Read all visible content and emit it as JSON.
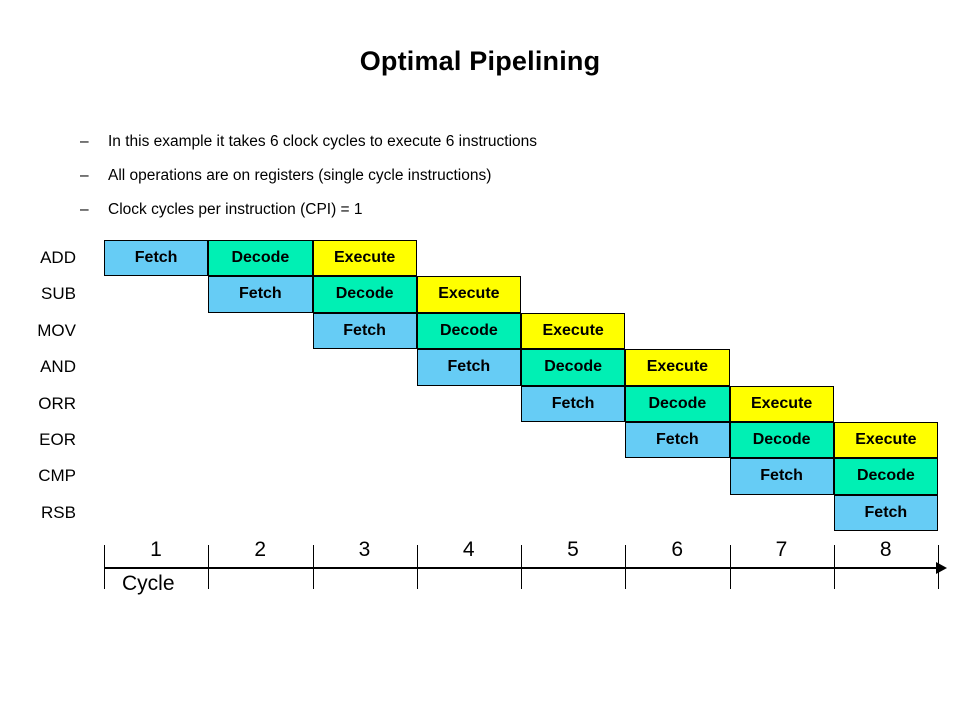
{
  "slide": {
    "title": "Optimal Pipelining",
    "bullet_marker": "–",
    "bullets": [
      "In this example it takes 6 clock cycles to execute 6 instructions",
      "All operations are on registers (single cycle instructions)",
      "Clock cycles per instruction (CPI) = 1"
    ]
  },
  "colors": {
    "fetch": "#66CCF5",
    "decode": "#00F0B4",
    "execute": "#FFFF00",
    "border": "#000000",
    "text": "#000000",
    "background": "#FFFFFF"
  },
  "chart_data": {
    "type": "table",
    "title": "Optimal Pipelining",
    "xlabel": "Cycle",
    "ylabel": "",
    "x": [
      1,
      2,
      3,
      4,
      5,
      6,
      7,
      8
    ],
    "cycle_labels": [
      "1",
      "2",
      "3",
      "4",
      "5",
      "6",
      "7",
      "8"
    ],
    "instructions": [
      "ADD",
      "SUB",
      "MOV",
      "AND",
      "ORR",
      "EOR",
      "CMP",
      "RSB"
    ],
    "stage_names": [
      "Fetch",
      "Decode",
      "Execute"
    ],
    "rows": [
      {
        "instruction": "ADD",
        "cells": [
          {
            "cycle": 1,
            "stage": "Fetch"
          },
          {
            "cycle": 2,
            "stage": "Decode"
          },
          {
            "cycle": 3,
            "stage": "Execute"
          }
        ]
      },
      {
        "instruction": "SUB",
        "cells": [
          {
            "cycle": 2,
            "stage": "Fetch"
          },
          {
            "cycle": 3,
            "stage": "Decode"
          },
          {
            "cycle": 4,
            "stage": "Execute"
          }
        ]
      },
      {
        "instruction": "MOV",
        "cells": [
          {
            "cycle": 3,
            "stage": "Fetch"
          },
          {
            "cycle": 4,
            "stage": "Decode"
          },
          {
            "cycle": 5,
            "stage": "Execute"
          }
        ]
      },
      {
        "instruction": "AND",
        "cells": [
          {
            "cycle": 4,
            "stage": "Fetch"
          },
          {
            "cycle": 5,
            "stage": "Decode"
          },
          {
            "cycle": 6,
            "stage": "Execute"
          }
        ]
      },
      {
        "instruction": "ORR",
        "cells": [
          {
            "cycle": 5,
            "stage": "Fetch"
          },
          {
            "cycle": 6,
            "stage": "Decode"
          },
          {
            "cycle": 7,
            "stage": "Execute"
          }
        ]
      },
      {
        "instruction": "EOR",
        "cells": [
          {
            "cycle": 6,
            "stage": "Fetch"
          },
          {
            "cycle": 7,
            "stage": "Decode"
          },
          {
            "cycle": 8,
            "stage": "Execute"
          }
        ]
      },
      {
        "instruction": "CMP",
        "cells": [
          {
            "cycle": 7,
            "stage": "Fetch"
          },
          {
            "cycle": 8,
            "stage": "Decode"
          }
        ]
      },
      {
        "instruction": "RSB",
        "cells": [
          {
            "cycle": 8,
            "stage": "Fetch"
          }
        ]
      }
    ]
  }
}
